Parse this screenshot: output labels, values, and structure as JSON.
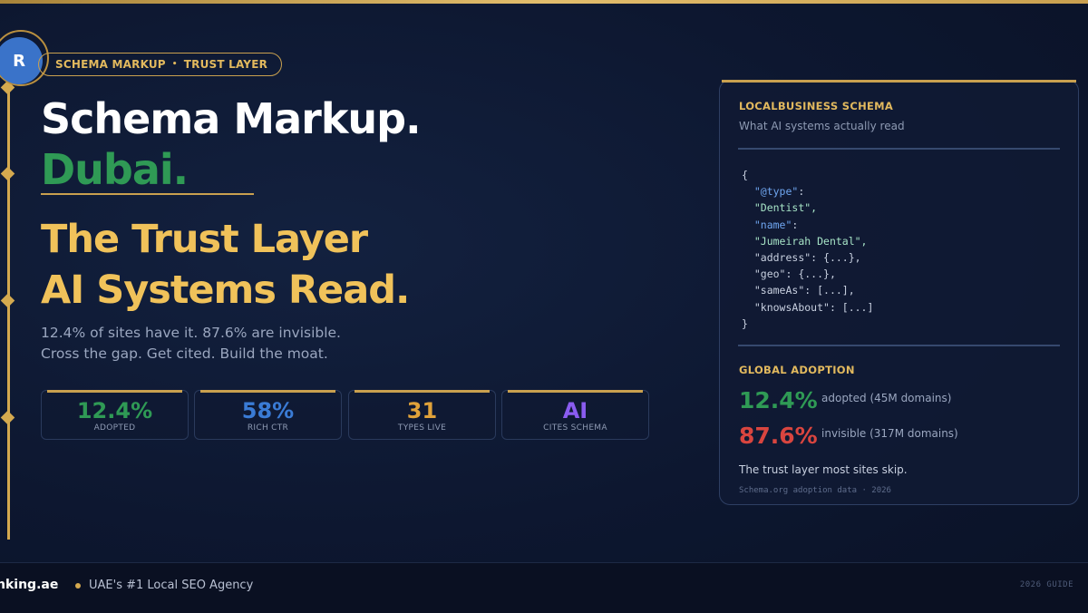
{
  "colors": {
    "gold": "#d4a94f",
    "green": "#2f9a55",
    "red": "#d9453f",
    "blue": "#3a7bd5",
    "orange": "#e0a23a",
    "purple": "#8a5cf0",
    "navy": "#0d1730"
  },
  "logo": {
    "letter": "R"
  },
  "badge": {
    "left": "SCHEMA MARKUP",
    "sep": "•",
    "right": "TRUST LAYER"
  },
  "hero": {
    "title_line1": "Schema Markup.",
    "title_line2": "Dubai.",
    "headline_line1": "The Trust Layer",
    "headline_line2": "AI Systems Read.",
    "sub_line1": "12.4% of sites have it. 87.6% are invisible.",
    "sub_line2": "Cross the gap. Get cited. Build the moat."
  },
  "stats": [
    {
      "value": "12.4%",
      "label": "ADOPTED"
    },
    {
      "value": "58%",
      "label": "RICH CTR"
    },
    {
      "value": "31",
      "label": "TYPES LIVE"
    },
    {
      "value": "AI",
      "label": "CITES SCHEMA"
    }
  ],
  "card": {
    "title": "LOCALBUSINESS SCHEMA",
    "subtitle": "What AI systems actually read",
    "code": {
      "open": "{",
      "type_key": "\"@type\"",
      "type_val": "\"Dentist\",",
      "name_key": "\"name\"",
      "name_val": "\"Jumeirah Dental\",",
      "address": "\"address\": {...},",
      "geo": "\"geo\": {...},",
      "sameas": "\"sameAs\": [...],",
      "knows": "\"knowsAbout\": [...]",
      "close": "}"
    },
    "adoption_title": "GLOBAL ADOPTION",
    "adopted_value": "12.4%",
    "adopted_desc": "adopted (45M domains)",
    "invisible_value": "87.6%",
    "invisible_desc": "invisible (317M domains)",
    "note": "The trust layer most sites skip.",
    "source": "Schema.org adoption data  ·  2026"
  },
  "footer": {
    "brand": "nking.ae",
    "tagline": "UAE's #1 Local SEO Agency",
    "guide": "2026 GUIDE"
  }
}
